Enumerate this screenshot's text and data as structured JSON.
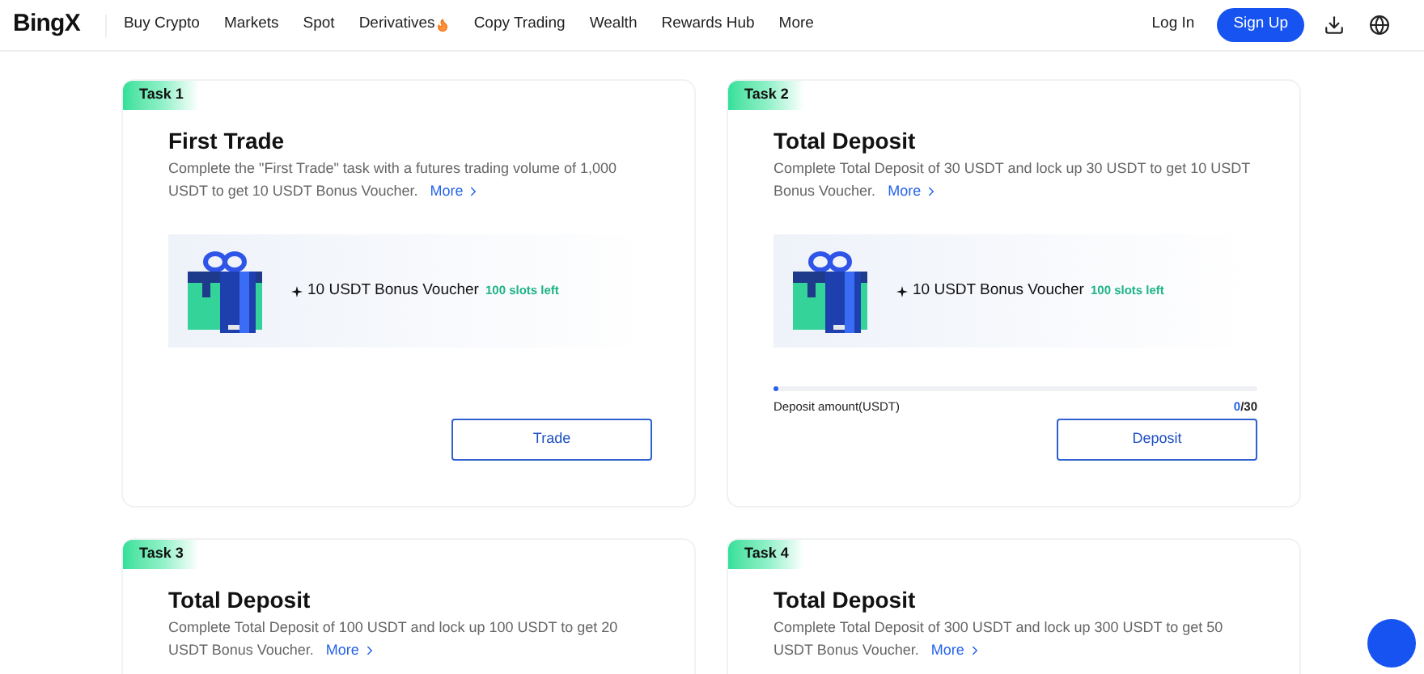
{
  "header": {
    "logo": "BingX",
    "nav": [
      {
        "label": "Buy Crypto",
        "hot": false
      },
      {
        "label": "Markets",
        "hot": false
      },
      {
        "label": "Spot",
        "hot": false
      },
      {
        "label": "Derivatives",
        "hot": true
      },
      {
        "label": "Copy Trading",
        "hot": false
      },
      {
        "label": "Wealth",
        "hot": false
      },
      {
        "label": "Rewards Hub",
        "hot": false
      },
      {
        "label": "More",
        "hot": false
      }
    ],
    "login": "Log In",
    "signup": "Sign Up"
  },
  "tasks": [
    {
      "tag": "Task 1",
      "title": "First Trade",
      "description": "Complete the \"First Trade\" task with a futures trading volume of 1,000 USDT to get 10 USDT Bonus Voucher.",
      "more": "More",
      "reward": {
        "voucher": "10 USDT Bonus Voucher",
        "slots": "100 slots left"
      },
      "button": "Trade"
    },
    {
      "tag": "Task 2",
      "title": "Total Deposit",
      "description": "Complete Total Deposit of 30 USDT and lock up 30 USDT to get 10 USDT Bonus Voucher.",
      "more": "More",
      "reward": {
        "voucher": "10 USDT Bonus Voucher",
        "slots": "100 slots left"
      },
      "progress": {
        "label": "Deposit amount(USDT)",
        "current": "0",
        "total": "/30",
        "level": 0
      },
      "button": "Deposit"
    },
    {
      "tag": "Task 3",
      "title": "Total Deposit",
      "description": "Complete Total Deposit of 100 USDT and lock up 100 USDT to get 20 USDT Bonus Voucher.",
      "more": "More"
    },
    {
      "tag": "Task 4",
      "title": "Total Deposit",
      "description": "Complete Total Deposit of 300 USDT and lock up 300 USDT to get 50 USDT Bonus Voucher.",
      "more": "More"
    }
  ]
}
